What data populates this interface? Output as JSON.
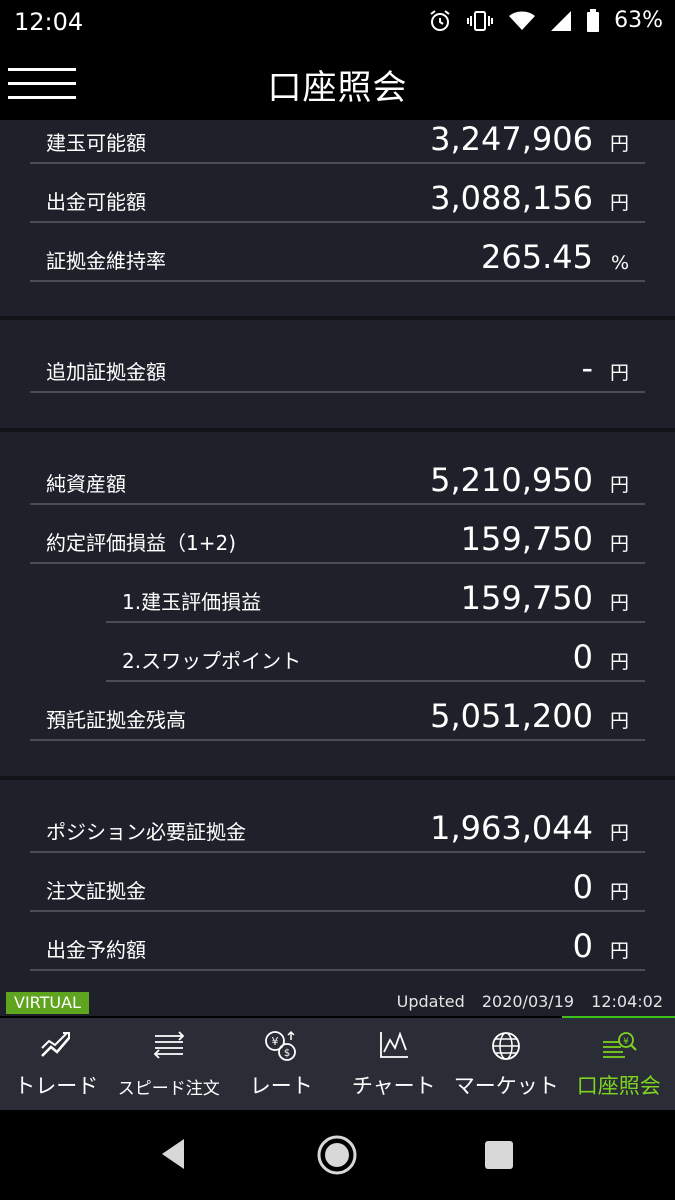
{
  "status_bar": {
    "time": "12:04",
    "battery": "63%"
  },
  "app_bar": {
    "title": "口座照会"
  },
  "section1": [
    {
      "label": "建玉可能額",
      "value": "3,247,906",
      "unit": "円"
    },
    {
      "label": "出金可能額",
      "value": "3,088,156",
      "unit": "円"
    },
    {
      "label": "証拠金維持率",
      "value": "265.45",
      "unit": "%"
    }
  ],
  "section2": [
    {
      "label": "追加証拠金額",
      "value": "-",
      "unit": "円"
    }
  ],
  "section3": [
    {
      "label": "純資産額",
      "value": "5,210,950",
      "unit": "円"
    },
    {
      "label": "約定評価損益（1+2)",
      "value": "159,750",
      "unit": "円"
    },
    {
      "label": "1.建玉評価損益",
      "value": "159,750",
      "unit": "円"
    },
    {
      "label": "2.スワップポイント",
      "value": "0",
      "unit": "円"
    },
    {
      "label": "預託証拠金残高",
      "value": "5,051,200",
      "unit": "円"
    }
  ],
  "section4": [
    {
      "label": "ポジション必要証拠金",
      "value": "1,963,044",
      "unit": "円"
    },
    {
      "label": "注文証拠金",
      "value": "0",
      "unit": "円"
    },
    {
      "label": "出金予約額",
      "value": "0",
      "unit": "円"
    }
  ],
  "footer": {
    "badge": "VIRTUAL",
    "updated_label": "Updated",
    "updated_date": "2020/03/19",
    "updated_time": "12:04:02"
  },
  "tabs": [
    {
      "label": "トレード",
      "icon": "trend-chart-icon"
    },
    {
      "label": "スピード注文",
      "icon": "speed-order-icon"
    },
    {
      "label": "レート",
      "icon": "currency-rate-icon"
    },
    {
      "label": "チャート",
      "icon": "line-chart-icon"
    },
    {
      "label": "マーケット",
      "icon": "globe-icon"
    },
    {
      "label": "口座照会",
      "icon": "account-inquiry-icon",
      "active": true
    }
  ],
  "colors": {
    "accent": "#7ed321",
    "badge": "#5fa41e",
    "background": "#1e212a",
    "tabbar": "#2a2d36"
  }
}
